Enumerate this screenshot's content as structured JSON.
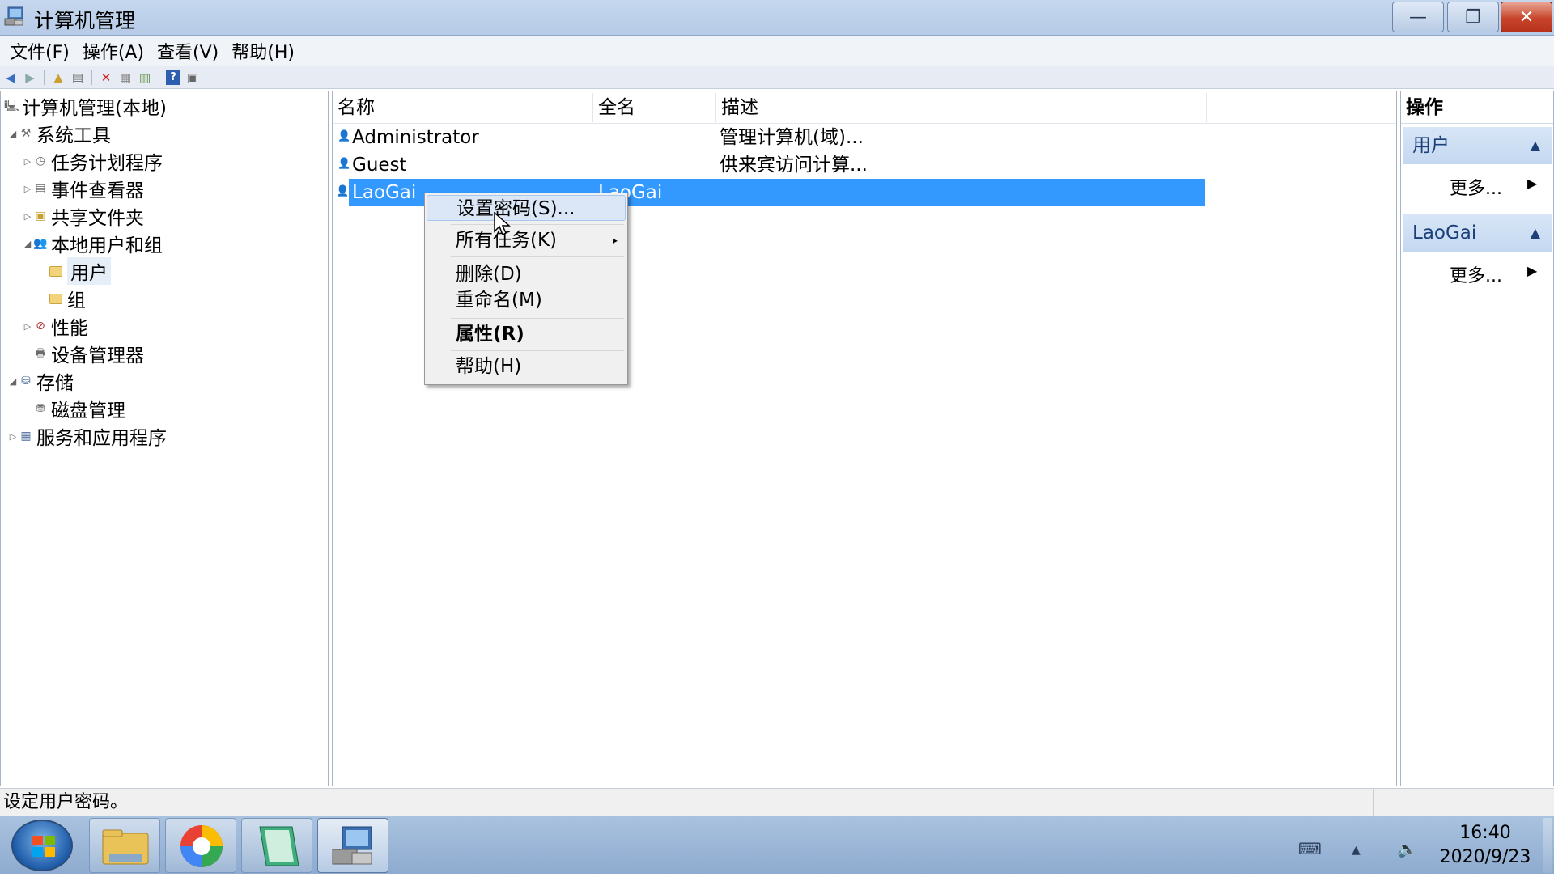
{
  "window": {
    "title": "计算机管理",
    "minimize": "—",
    "maximize": "❐",
    "close": "✕"
  },
  "menubar": [
    "文件(F)",
    "操作(A)",
    "查看(V)",
    "帮助(H)"
  ],
  "tree": {
    "root": "计算机管理(本地)",
    "system_tools": "系统工具",
    "task_scheduler": "任务计划程序",
    "event_viewer": "事件查看器",
    "shared_folders": "共享文件夹",
    "local_users_groups": "本地用户和组",
    "users": "用户",
    "groups": "组",
    "performance": "性能",
    "device_manager": "设备管理器",
    "storage": "存储",
    "disk_management": "磁盘管理",
    "services_apps": "服务和应用程序"
  },
  "list": {
    "headers": [
      "名称",
      "全名",
      "描述"
    ],
    "rows": [
      {
        "name": "Administrator",
        "fullname": "",
        "desc": "管理计算机(域)..."
      },
      {
        "name": "Guest",
        "fullname": "",
        "desc": "供来宾访问计算..."
      },
      {
        "name": "LaoGai",
        "fullname": "LaoGai",
        "desc": ""
      }
    ],
    "selected_row": "LaoGai"
  },
  "context_menu": {
    "set_password": "设置密码(S)...",
    "all_tasks": "所有任务(K)",
    "delete": "删除(D)",
    "rename": "重命名(M)",
    "properties": "属性(R)",
    "help": "帮助(H)"
  },
  "actions": {
    "title": "操作",
    "section1": "用户",
    "section1_more": "更多...",
    "section2": "LaoGai",
    "section2_more": "更多..."
  },
  "statusbar": {
    "text": "设定用户密码。"
  },
  "taskbar": {
    "time": "16:40",
    "date": "2020/9/23"
  },
  "colors": {
    "selection": "#3399ff",
    "titlebar": "#c5d7ee",
    "close_button": "#c8452c"
  }
}
